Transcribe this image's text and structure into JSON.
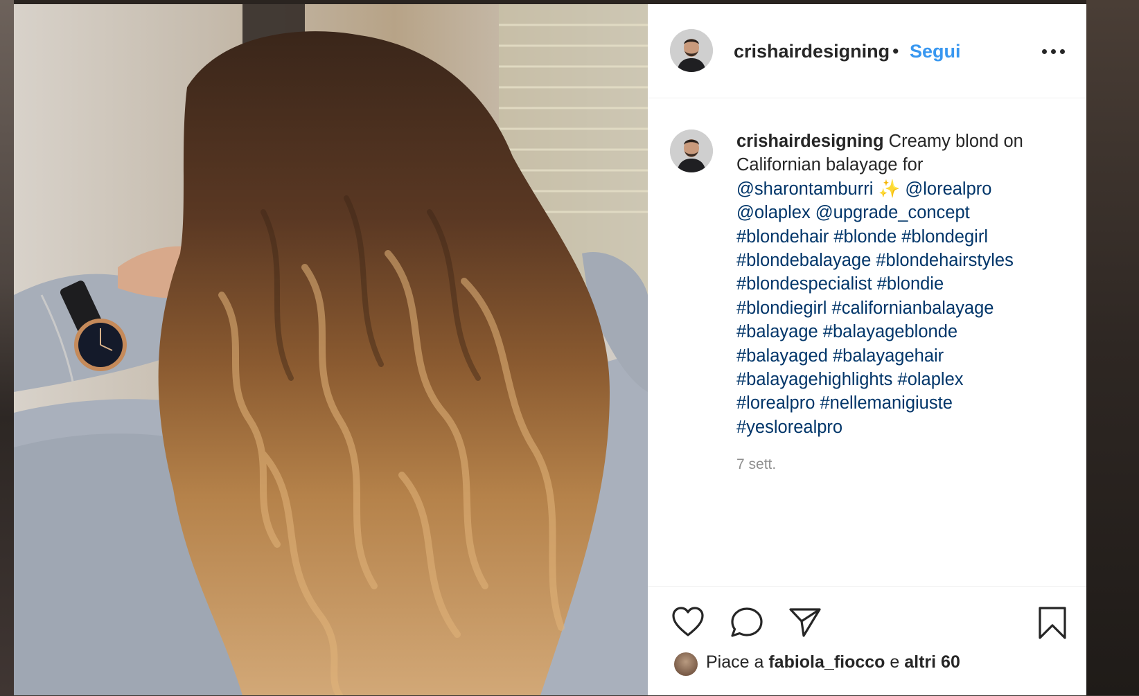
{
  "post": {
    "username": "crishairdesigning",
    "separator": "•",
    "follow_label": "Segui",
    "more_icon": "more-horizontal-icon"
  },
  "caption": {
    "username": "crishairdesigning",
    "text": "Creamy blond on Californian balayage for",
    "mentions": [
      "@sharontamburri",
      "@lorealpro",
      "@olaplex",
      "@upgrade_concept"
    ],
    "sparkles": "✨",
    "hashtags": [
      "#blondehair",
      "#blonde",
      "#blondegirl",
      "#blondebalayage",
      "#blondehairstyles",
      "#blondespecialist",
      "#blondie",
      "#blondiegirl",
      "#californianbalayage",
      "#balayage",
      "#balayageblonde",
      "#balayaged",
      "#balayagehair",
      "#balayagehighlights",
      "#olaplex",
      "#lorealpro",
      "#nellemanigiuste",
      "#yeslorealpro"
    ],
    "timestamp": "7 sett."
  },
  "actions": {
    "like_icon": "heart-icon",
    "comment_icon": "comment-icon",
    "share_icon": "paper-plane-icon",
    "save_icon": "bookmark-icon"
  },
  "likes": {
    "prefix": "Piace a",
    "user": "fabiola_fiocco",
    "connector": "e",
    "others": "altri 60"
  },
  "colors": {
    "link": "#003569",
    "follow": "#3897f0",
    "text": "#262626",
    "muted": "#8e8e8e"
  }
}
